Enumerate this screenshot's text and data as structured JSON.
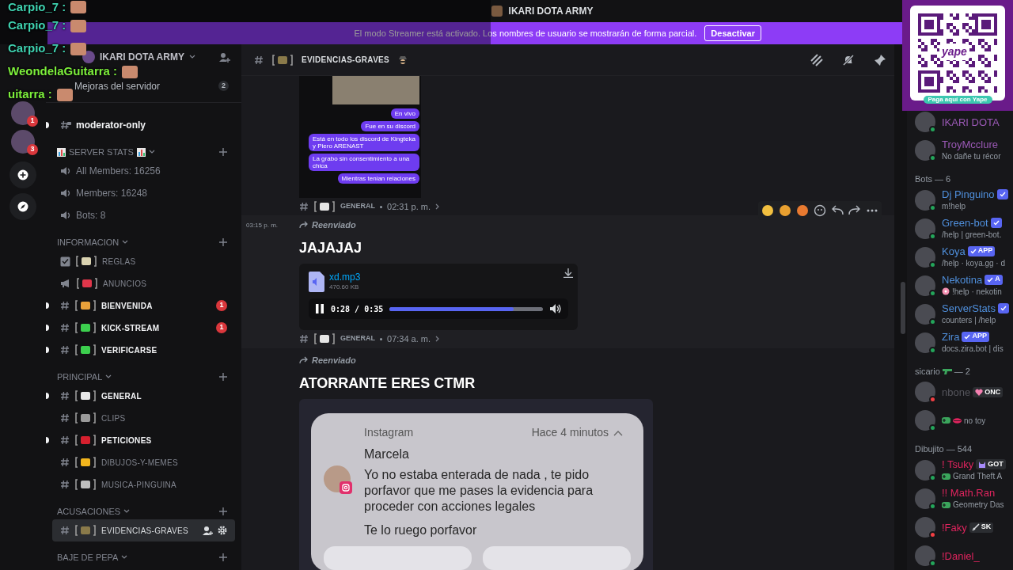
{
  "overlay_chat": [
    {
      "name": "Carpio_7 :",
      "color": "#3fd2b0"
    },
    {
      "name": "Carpio_7 :",
      "color": "#3fd2b0"
    },
    {
      "name": "Carpio_7 :",
      "color": "#3fd2b0"
    },
    {
      "name": "WeondelaGuitarra :",
      "color": "#7df03c"
    },
    {
      "name": "uitarra :",
      "color": "#7df03c"
    }
  ],
  "title_bar": {
    "title": "IKARI DOTA ARMY"
  },
  "banner": {
    "text": "El modo Streamer está activado. Los nombres de usuario se mostrarán de forma parcial.",
    "button": "Desactivar"
  },
  "servers": [
    {
      "badge": "1"
    },
    {
      "badge": "3"
    }
  ],
  "sidebar": {
    "server_name": "IKARI DOTA ARMY",
    "boosts": {
      "label": "Mejoras del servidor",
      "count": "2"
    },
    "channels": [
      {
        "kind": "private",
        "name": "moderator-only",
        "unread": true,
        "selected": false
      }
    ],
    "categories": [
      {
        "name": "SERVER STATS",
        "decorated": true,
        "channels": [
          {
            "kind": "voice",
            "name": "All Members: 16256",
            "unread": false,
            "selected": false
          },
          {
            "kind": "voice",
            "name": "Members: 16248",
            "unread": false,
            "selected": false
          },
          {
            "kind": "voice",
            "name": "Bots: 8",
            "unread": false,
            "selected": false
          }
        ]
      },
      {
        "name": "INFORMACION",
        "decorated": false,
        "channels": [
          {
            "kind": "rules",
            "name": "REGLAS",
            "color": "#d9d2b0",
            "unread": false,
            "selected": false
          },
          {
            "kind": "announce",
            "name": "ANUNCIOS",
            "color": "#e0364a",
            "unread": false,
            "selected": false
          },
          {
            "kind": "text",
            "name": "BIENVENIDA",
            "color": "#e8a13a",
            "unread": true,
            "badge": "1",
            "selected": false
          },
          {
            "kind": "text",
            "name": "KICK-STREAM",
            "color": "#3ccf4e",
            "unread": true,
            "badge": "1",
            "selected": false
          },
          {
            "kind": "text",
            "name": "VERIFICARSE",
            "color": "#3ccf4e",
            "unread": true,
            "selected": false
          }
        ]
      },
      {
        "name": "PRINCIPAL",
        "decorated": false,
        "channels": [
          {
            "kind": "text",
            "name": "GENERAL",
            "color": "#e6e6e6",
            "unread": true,
            "selected": false
          },
          {
            "kind": "text",
            "name": "CLIPS",
            "color": "#9a9a9a",
            "unread": false,
            "selected": false
          },
          {
            "kind": "text",
            "name": "PETICIONES",
            "color": "#d6202e",
            "unread": true,
            "selected": false
          },
          {
            "kind": "text",
            "name": "DIBUJOS-Y-MEMES",
            "color": "#f2b51d",
            "unread": false,
            "selected": false
          },
          {
            "kind": "text",
            "name": "MUSICA-PINGUINA",
            "color": "#bfbfbf",
            "unread": false,
            "selected": false
          }
        ]
      },
      {
        "name": "ACUSACIONES",
        "decorated": false,
        "channels": [
          {
            "kind": "text",
            "name": "EVIDENCIAS-GRAVES",
            "color": "#8a7a4a",
            "unread": false,
            "selected": true
          }
        ]
      },
      {
        "name": "BAJE DE PEPA",
        "decorated": false
      }
    ]
  },
  "channel_header": {
    "name": "EVIDENCIAS-GRAVES",
    "color": "#8a7a4a"
  },
  "messages": [
    {
      "kind": "image",
      "bubbles": [
        "En vivo",
        "Fue en su discord",
        "Está en todo los discord de Kingteka y Piero ARENAST",
        "La grabo sin consentimiento a una chica",
        "Mientras tenian relaciones"
      ],
      "source": {
        "channel": "GENERAL",
        "time": "02:31 p. m."
      }
    },
    {
      "kind": "audio",
      "time": "03:15 p. m.",
      "forwarded": "Reenviado",
      "text": "JAJAJAJ",
      "attachment": {
        "name": "xd.mp3",
        "size": "470.60 KB",
        "position": "0:28 / 0:35",
        "level": 0.81
      },
      "source": {
        "channel": "GENERAL",
        "time": "07:34 a. m."
      }
    },
    {
      "kind": "notification",
      "forwarded": "Reenviado",
      "text": "ATORRANTE ERES CTMR",
      "notification": {
        "app": "Instagram",
        "ago": "Hace 4 minutos",
        "sender": "Marcela",
        "body": "Yo no estaba enterada de nada , te pido porfavor que me pases la evidencia para proceder con acciones legales",
        "footer": "Te lo ruego porfavor"
      }
    }
  ],
  "qr": {
    "logo": "yape",
    "caption": "Paga aquí con Yape"
  },
  "members": [
    {
      "members": [
        {
          "name": "IKARI DOTA",
          "color": "#9b59b6",
          "dnd": false
        },
        {
          "name": "TroyMcclure",
          "color": "#9b59b6",
          "dnd": false,
          "activity": {
            "kind": "text",
            "text": "No dañe tu récor"
          }
        }
      ]
    },
    {
      "title": "Bots",
      "count": "— 6",
      "members": [
        {
          "name": "Dj Pinguino",
          "color": "#4f8fdc",
          "dnd": false,
          "verified": true,
          "activity": {
            "kind": "text",
            "text": "m!help"
          }
        },
        {
          "name": "Green-bot",
          "color": "#4f8fdc",
          "dnd": false,
          "verified": true,
          "activity": {
            "kind": "text",
            "text": "/help | green-bot."
          }
        },
        {
          "name": "Koya",
          "color": "#4f8fdc",
          "dnd": false,
          "verified": true,
          "tag": "APP",
          "activity": {
            "kind": "text",
            "text": "/help · koya.gg · d"
          }
        },
        {
          "name": "Nekotina",
          "color": "#4f8fdc",
          "dnd": false,
          "verified": true,
          "tag": "A",
          "activity": {
            "kind": "flower",
            "text": "!help · nekotin"
          }
        },
        {
          "name": "ServerStats",
          "color": "#4f8fdc",
          "dnd": false,
          "verified": true,
          "activity": {
            "kind": "text",
            "text": "counters | /help"
          }
        },
        {
          "name": "Zira",
          "color": "#4f8fdc",
          "dnd": false,
          "verified": true,
          "tag": "APP",
          "activity": {
            "kind": "text",
            "text": "docs.zira.bot | dis"
          }
        }
      ]
    },
    {
      "title": "sicario",
      "emoji": true,
      "count": "— 2",
      "members": [
        {
          "name": "nbone",
          "color": "#55555c",
          "dnd": true,
          "role": {
            "kind": "heart",
            "text": "ONC"
          }
        },
        {
          "dnd": false,
          "activity": {
            "kind": "game_kiss",
            "text": "no toy"
          }
        }
      ]
    },
    {
      "title": "Dibujito",
      "count": "— 544",
      "members": [
        {
          "name": "! Tsuky",
          "color": "#e0245e",
          "dnd": false,
          "role": {
            "kind": "cat",
            "text": "GOT"
          },
          "activity": {
            "kind": "game",
            "text": "Grand Theft A"
          }
        },
        {
          "name": "!! Math.Ran",
          "color": "#e0245e",
          "dnd": false,
          "activity": {
            "kind": "game",
            "text": "Geometry Das"
          }
        },
        {
          "name": "!Faky",
          "color": "#e0245e",
          "dnd": true,
          "role": {
            "kind": "sword",
            "text": "SK"
          }
        },
        {
          "name": "!Daniel_",
          "color": "#e0245e",
          "dnd": false
        }
      ]
    }
  ]
}
